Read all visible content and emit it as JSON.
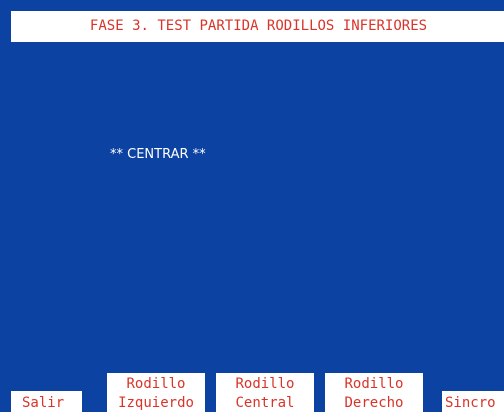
{
  "header": {
    "title": "FASE 3. TEST PARTIDA RODILLOS INFERIORES"
  },
  "main": {
    "status_text": "** CENTRAR **"
  },
  "function_keys": [
    {
      "lines": [
        "Salir"
      ]
    },
    {
      "lines": [
        "Rodillo",
        "Izquierdo"
      ]
    },
    {
      "lines": [
        "Rodillo",
        "Central"
      ]
    },
    {
      "lines": [
        "Rodillo",
        "Derecho"
      ]
    },
    {
      "lines": [
        "Sincro"
      ]
    }
  ],
  "colors": {
    "background": "#0c42a2",
    "panel": "#ffffff",
    "label_text": "#d9342a",
    "status_text": "#ffffff"
  }
}
